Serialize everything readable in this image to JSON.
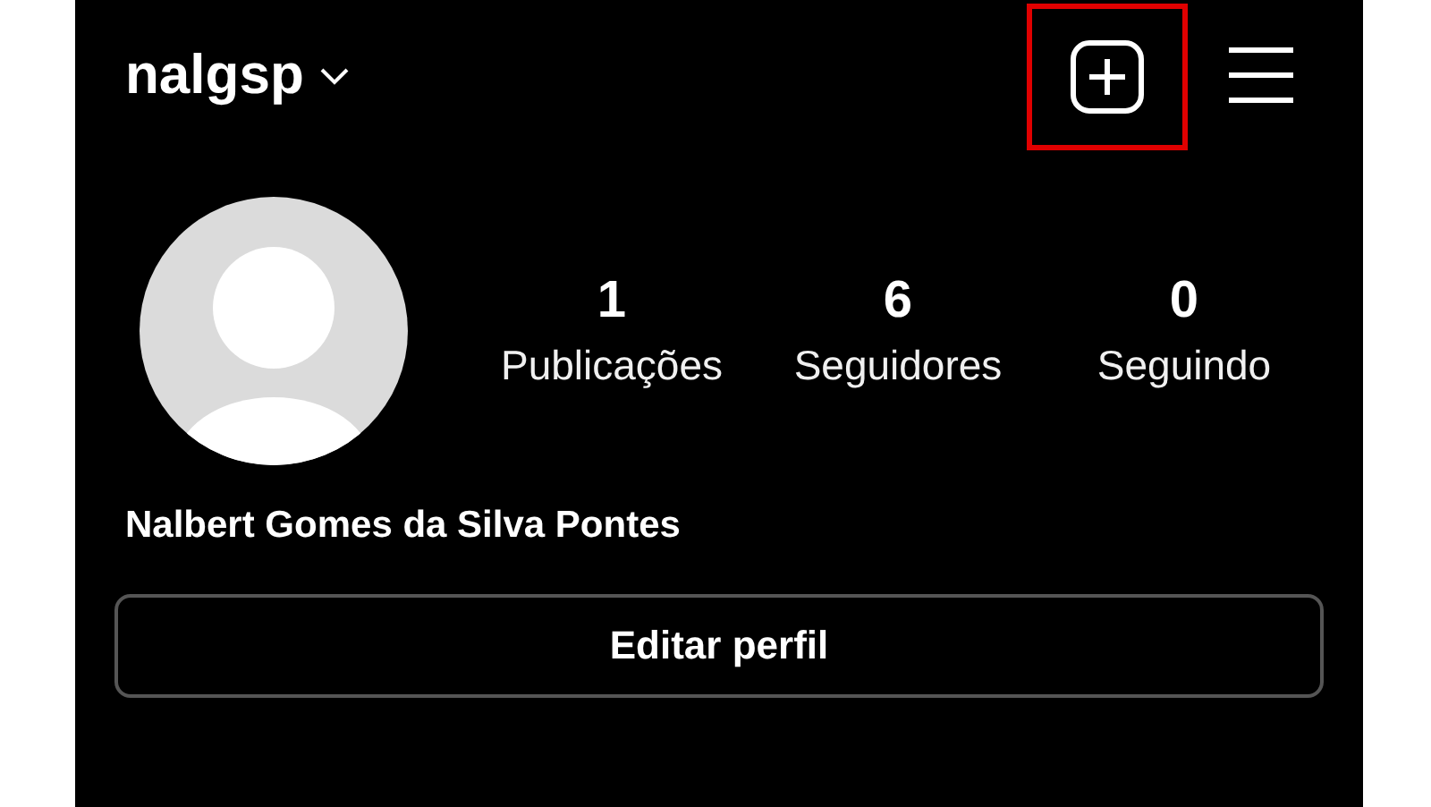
{
  "header": {
    "username": "nalgsp",
    "new_post": {
      "highlighted": true
    }
  },
  "profile": {
    "stats": [
      {
        "value": "1",
        "label": "Publicações"
      },
      {
        "value": "6",
        "label": "Seguidores"
      },
      {
        "value": "0",
        "label": "Seguindo"
      }
    ],
    "name": "Nalbert Gomes da Silva Pontes"
  },
  "edit_button": "Editar perfil"
}
